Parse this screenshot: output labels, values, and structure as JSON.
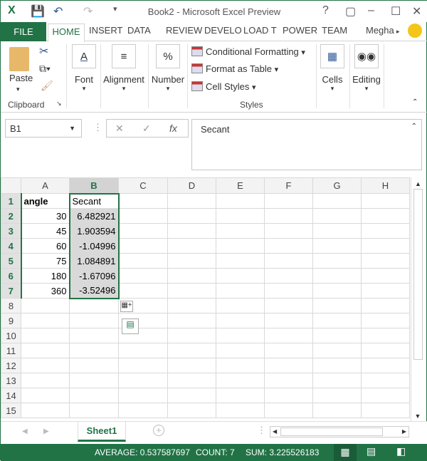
{
  "window": {
    "title": "Book2 - Microsoft Excel Preview"
  },
  "tabs": {
    "file": "FILE",
    "home": "HOME",
    "insert": "INSERT",
    "data": "DATA",
    "review": "REVIEW",
    "develo": "DEVELO",
    "load": "LOAD T",
    "power": "POWER",
    "team": "TEAM",
    "user": "Megha"
  },
  "ribbon": {
    "paste": "Paste",
    "clipboard": "Clipboard",
    "font": "Font",
    "alignment": "Alignment",
    "number": "Number",
    "conditional": "Conditional Formatting",
    "format_table": "Format as Table",
    "cell_styles": "Cell Styles",
    "styles": "Styles",
    "cells": "Cells",
    "editing": "Editing"
  },
  "formula_bar": {
    "name_box": "B1",
    "fx": "fx",
    "value": "Secant"
  },
  "columns": [
    "A",
    "B",
    "C",
    "D",
    "E",
    "F",
    "G",
    "H"
  ],
  "rows": [
    {
      "n": "1",
      "a": "angle",
      "b": "Secant"
    },
    {
      "n": "2",
      "a": "30",
      "b": "6.482921"
    },
    {
      "n": "3",
      "a": "45",
      "b": "1.903594"
    },
    {
      "n": "4",
      "a": "60",
      "b": "-1.04996"
    },
    {
      "n": "5",
      "a": "75",
      "b": "1.084891"
    },
    {
      "n": "6",
      "a": "180",
      "b": "-1.67096"
    },
    {
      "n": "7",
      "a": "360",
      "b": "-3.52496"
    },
    {
      "n": "8"
    },
    {
      "n": "9"
    },
    {
      "n": "10"
    },
    {
      "n": "11"
    },
    {
      "n": "12"
    },
    {
      "n": "13"
    },
    {
      "n": "14"
    },
    {
      "n": "15"
    }
  ],
  "sheets": [
    "Sheet1"
  ],
  "status": {
    "average": "AVERAGE: 0.537587697",
    "count": "COUNT: 7",
    "sum": "SUM: 3.225526183"
  }
}
